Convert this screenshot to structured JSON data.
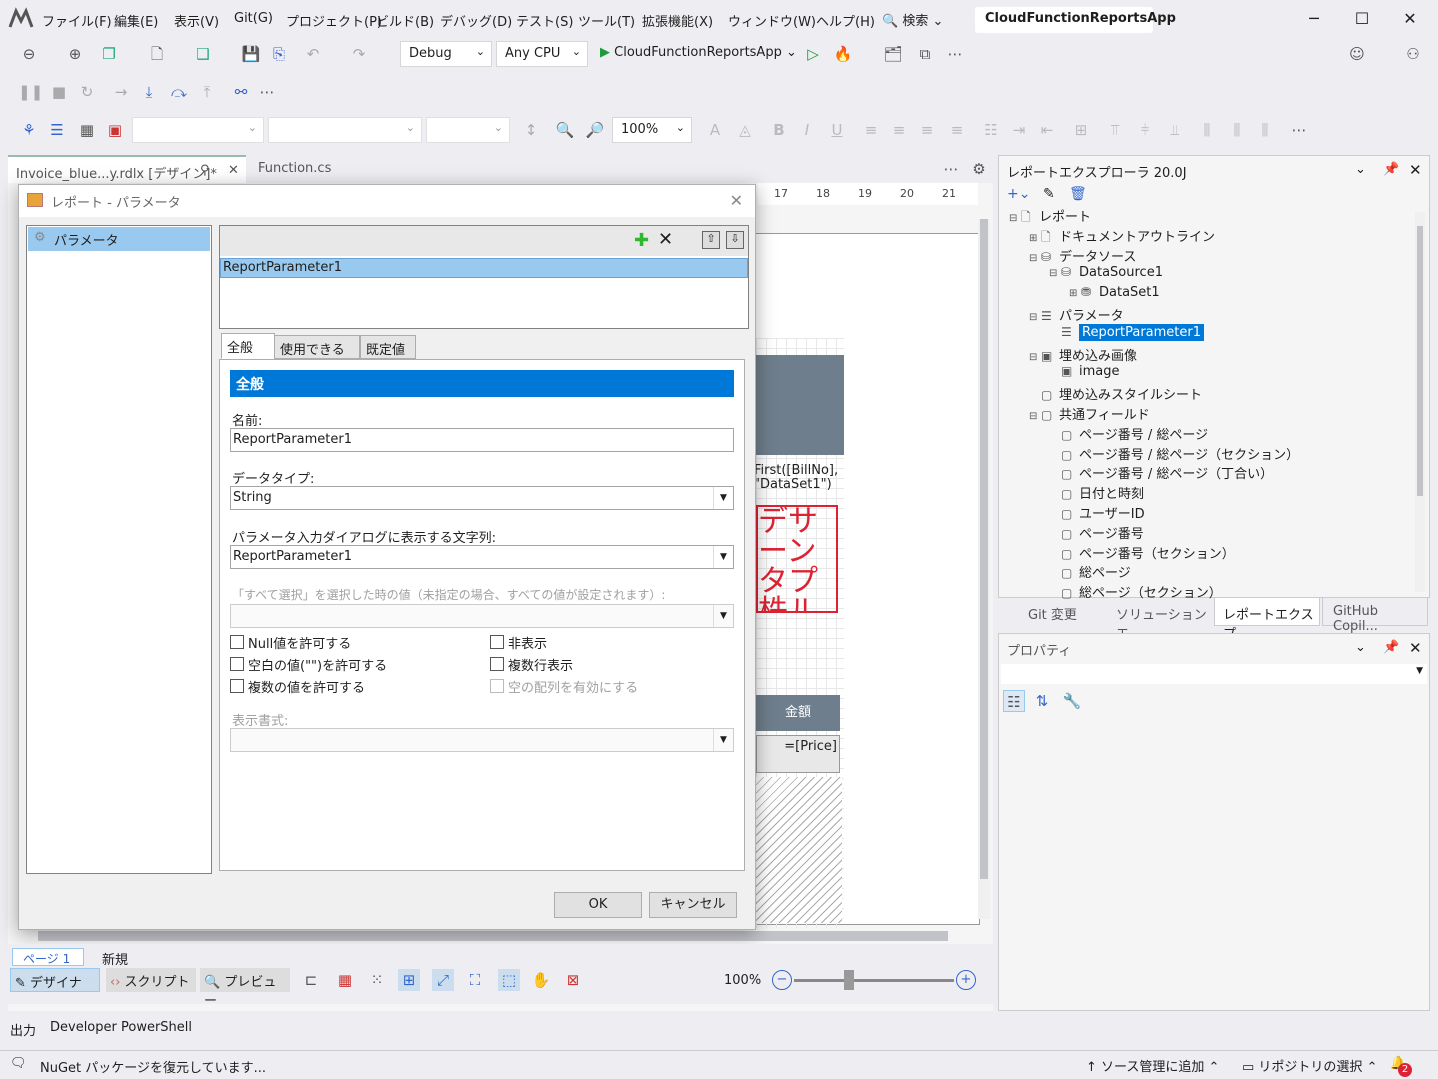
{
  "menu": [
    "ファイル(F)",
    "編集(E)",
    "表示(V)",
    "Git(G)",
    "プロジェクト(P)",
    "ビルド(B)",
    "デバッグ(D)",
    "テスト(S)",
    "ツール(T)",
    "拡張機能(X)",
    "ウィンドウ(W)",
    "ヘルプ(H)"
  ],
  "search_label": "検索",
  "app_title": "CloudFunctionReportsApp",
  "toolbar": {
    "config": "Debug",
    "platform": "Any CPU",
    "run_target": "CloudFunctionReportsApp",
    "zoom": "100%"
  },
  "doc_tabs": [
    "Invoice_blue...y.rdlx [デザイン]*",
    "Function.cs"
  ],
  "ruler_ticks": [
    "17",
    "18",
    "19",
    "20",
    "21"
  ],
  "designer_fragments": {
    "expr": "First([BillNo],\n\"DataSet1\")",
    "stamp": "デサ\nーン\nタプ\n株ル",
    "header": "金額",
    "price": "=[Price]"
  },
  "dialog": {
    "title": "レポート - パラメータ",
    "left_item": "パラメータ",
    "param_item": "ReportParameter1",
    "tabs": [
      "全般",
      "使用できる値",
      "既定値"
    ],
    "section": "全般",
    "name_label": "名前:",
    "name_value": "ReportParameter1",
    "datatype_label": "データタイプ:",
    "datatype_value": "String",
    "prompt_label": "パラメータ入力ダイアログに表示する文字列:",
    "prompt_value": "ReportParameter1",
    "allvalue_label": "「すべて選択」を選択した時の値（未指定の場合、すべての値が設定されます）:",
    "chk_null": "Null値を許可する",
    "chk_blank": "空白の値(\"\")を許可する",
    "chk_multi": "複数の値を許可する",
    "chk_hidden": "非表示",
    "chk_multiline": "複数行表示",
    "chk_emptyarray": "空の配列を有効にする",
    "format_label": "表示書式:",
    "ok": "OK",
    "cancel": "キャンセル"
  },
  "bottom": {
    "page_tab": "ページ 1",
    "new_tab": "新規",
    "designer": "デザイナ",
    "script": "スクリプト",
    "preview": "プレビュー",
    "zoom": "100%"
  },
  "explorer": {
    "title": "レポートエクスプローラ 20.0J",
    "nodes": [
      "レポート",
      "ドキュメントアウトライン",
      "データソース",
      "DataSource1",
      "DataSet1",
      "パラメータ",
      "ReportParameter1",
      "埋め込み画像",
      "image",
      "埋め込みスタイルシート",
      "共通フィールド",
      "ページ番号 / 総ページ",
      "ページ番号 / 総ページ（セクション）",
      "ページ番号 / 総ページ（丁合い）",
      "日付と時刻",
      "ユーザーID",
      "ページ番号",
      "ページ番号（セクション）",
      "総ページ",
      "総ページ（セクション）"
    ]
  },
  "panel_tabs": [
    "Git 変更",
    "ソリューション エ...",
    "レポートエクスプ...",
    "GitHub Copil..."
  ],
  "props_title": "プロパティ",
  "output_tabs": [
    "出力",
    "Developer PowerShell"
  ],
  "status": {
    "left": "NuGet パッケージを復元しています...",
    "scm": "ソース管理に追加",
    "repo": "リポジトリの選択",
    "badge": "2"
  }
}
